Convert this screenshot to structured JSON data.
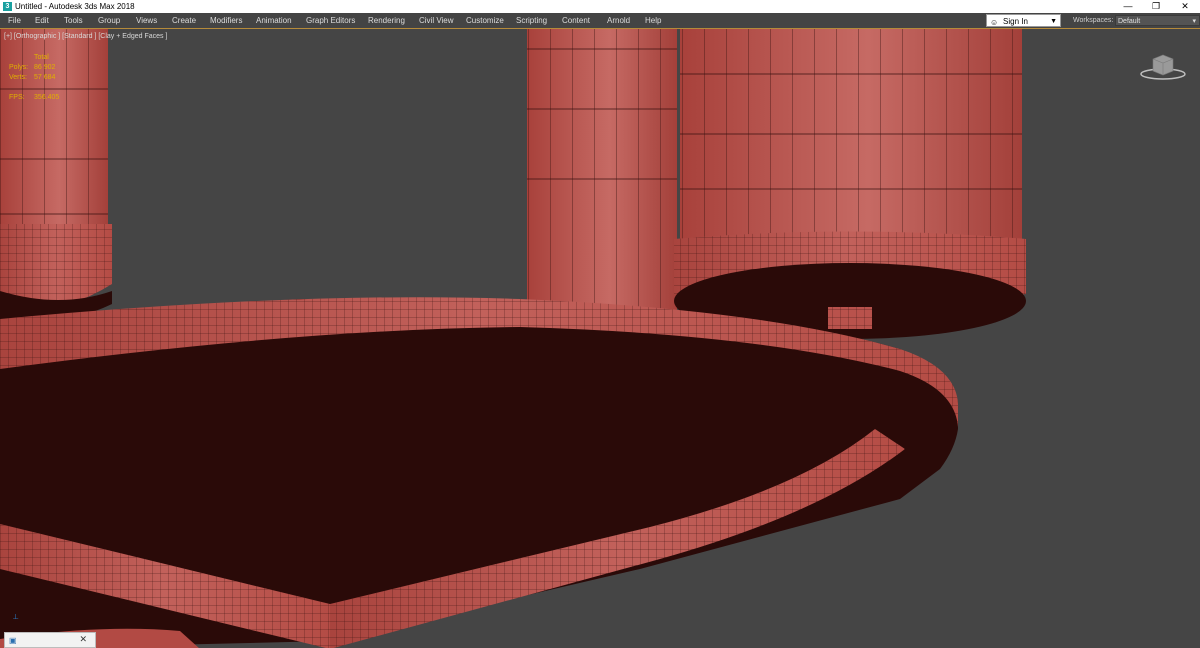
{
  "window": {
    "title": "Untitled - Autodesk 3ds Max 2018",
    "app_icon": "3",
    "controls": {
      "minimize": "—",
      "restore": "❐",
      "close": "✕"
    }
  },
  "menu": {
    "items": [
      "File",
      "Edit",
      "Tools",
      "Group",
      "Views",
      "Create",
      "Modifiers",
      "Animation",
      "Graph Editors",
      "Rendering",
      "Civil View",
      "Customize",
      "Scripting",
      "Content",
      "Arnold",
      "Help"
    ]
  },
  "account": {
    "signin_label": "Sign In",
    "user_icon": "user-icon"
  },
  "workspaces": {
    "label": "Workspaces:",
    "selected": "Default"
  },
  "viewport": {
    "label": "[+] [Orthographic ] [Standard ] [Clay + Edged Faces ]",
    "stats": {
      "header": "Total",
      "polys_label": "Polys:",
      "polys_value": "86 902",
      "verts_label": "Verts:",
      "verts_value": "57 684",
      "fps_label": "FPS:",
      "fps_value": "356.405"
    },
    "colors": {
      "background": "#454545",
      "clay": "#b94a44",
      "clay_dark": "#2a0a08",
      "wire": "#3a1210",
      "stats": "#e0b000"
    }
  }
}
